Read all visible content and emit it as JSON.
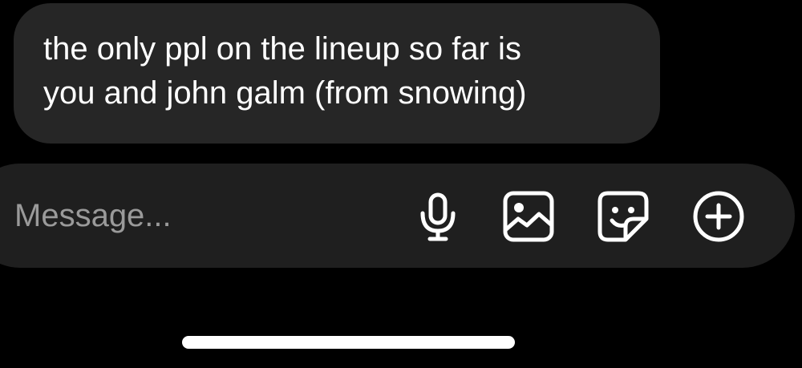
{
  "message": {
    "lines": [
      "the only ppl on the lineup so far is",
      "you and john galm (from snowing)"
    ]
  },
  "composer": {
    "placeholder": "Message...",
    "icons": [
      "microphone-icon",
      "image-icon",
      "sticker-icon",
      "add-icon"
    ]
  },
  "colors": {
    "background": "#000000",
    "bubble": "#262626",
    "composer": "#1f1f1f",
    "text": "#ffffff",
    "placeholder": "#9a9a9a"
  }
}
